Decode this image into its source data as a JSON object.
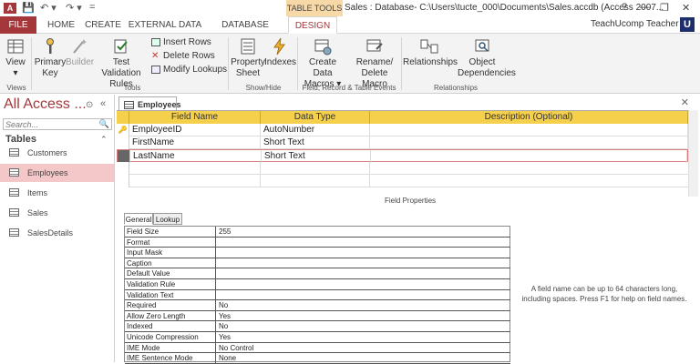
{
  "titlebar": {
    "app_icon": "A",
    "qat": {
      "save": "💾",
      "undo": "↶ ▾",
      "redo": "↷ ▾",
      "more": "="
    },
    "context_label": "TABLE TOOLS",
    "title": "Sales : Database- C:\\Users\\tucte_000\\Documents\\Sales.accdb (Access 2007...",
    "help": "?",
    "minimize": "—",
    "restore": "❐",
    "close": "✕"
  },
  "tabs": [
    "FILE",
    "HOME",
    "CREATE",
    "EXTERNAL DATA",
    "DATABASE TOOLS",
    "DESIGN"
  ],
  "user": {
    "name": "TeachUcomp Teacher ▾",
    "badge": "U"
  },
  "ribbon": {
    "view": {
      "label": "View",
      "sub": "▾"
    },
    "primary_key": {
      "label1": "Primary",
      "label2": "Key"
    },
    "builder": {
      "label": "Builder"
    },
    "test_rules": {
      "label1": "Test Validation",
      "label2": "Rules"
    },
    "insert_rows": "Insert Rows",
    "delete_rows": "Delete Rows",
    "modify_lookups": "Modify Lookups",
    "property_sheet": {
      "label1": "Property",
      "label2": "Sheet"
    },
    "indexes": {
      "label": "Indexes"
    },
    "create_macros": {
      "label1": "Create Data",
      "label2": "Macros ▾"
    },
    "rename_macro": {
      "label1": "Rename/",
      "label2": "Delete Macro"
    },
    "relationships": {
      "label": "Relationships"
    },
    "dependencies": {
      "label1": "Object",
      "label2": "Dependencies"
    },
    "groups": {
      "views": "Views",
      "tools": "Tools",
      "showhide": "Show/Hide",
      "events": "Field, Record & Table Events",
      "relationships": "Relationships"
    }
  },
  "nav": {
    "title": "All Access ...",
    "menu_icon": "⊙",
    "collapse_icon": "«",
    "search_placeholder": "Search...",
    "search_icon": "🔍",
    "section": "Tables",
    "section_arrow": "⌃",
    "items": [
      "Customers",
      "Employees",
      "Items",
      "Sales",
      "SalesDetails"
    ]
  },
  "document": {
    "tab": "Employees",
    "close": "✕",
    "columns": [
      "Field Name",
      "Data Type",
      "Description (Optional)"
    ],
    "rows": [
      {
        "key": "🔑",
        "field": "EmployeeID",
        "type": "AutoNumber",
        "desc": ""
      },
      {
        "key": "",
        "field": "FirstName",
        "type": "Short Text",
        "desc": ""
      },
      {
        "key": "",
        "field": "LastName",
        "type": "Short Text",
        "desc": ""
      }
    ],
    "field_properties_label": "Field Properties",
    "prop_tabs": [
      "General",
      "Lookup"
    ],
    "properties": [
      [
        "Field Size",
        "255"
      ],
      [
        "Format",
        ""
      ],
      [
        "Input Mask",
        ""
      ],
      [
        "Caption",
        ""
      ],
      [
        "Default Value",
        ""
      ],
      [
        "Validation Rule",
        ""
      ],
      [
        "Validation Text",
        ""
      ],
      [
        "Required",
        "No"
      ],
      [
        "Allow Zero Length",
        "Yes"
      ],
      [
        "Indexed",
        "No"
      ],
      [
        "Unicode Compression",
        "Yes"
      ],
      [
        "IME Mode",
        "No Control"
      ],
      [
        "IME Sentence Mode",
        "None"
      ]
    ],
    "help_text": "A field name can be up to 64 characters long, including spaces. Press F1 for help on field names."
  }
}
